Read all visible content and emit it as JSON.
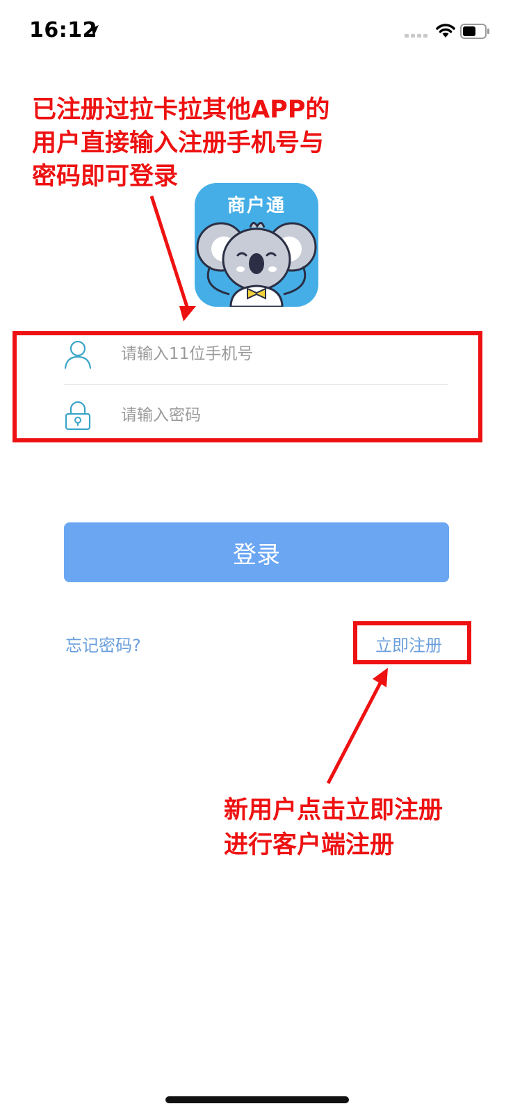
{
  "status_bar": {
    "time": "16:12",
    "icons": [
      "location-arrow-icon",
      "cellular-signal-icon",
      "wifi-icon",
      "battery-icon"
    ]
  },
  "annotations": {
    "top": "已注册过拉卡拉其他APP的\n用户直接输入注册手机号与\n密码即可登录",
    "bottom": "新用户点击立即注册\n进行客户端注册",
    "color": "#ee1111"
  },
  "app_logo": {
    "title": "商户通",
    "background": "#45aee6"
  },
  "login_form": {
    "phone_placeholder": "请输入11位手机号",
    "password_placeholder": "请输入密码",
    "login_label": "登录",
    "button_color": "#6ba6f3",
    "icon_color": "#3aa5c9"
  },
  "links": {
    "forgot_password": "忘记密码?",
    "register_now": "立即注册",
    "link_color": "#6a9edc"
  }
}
